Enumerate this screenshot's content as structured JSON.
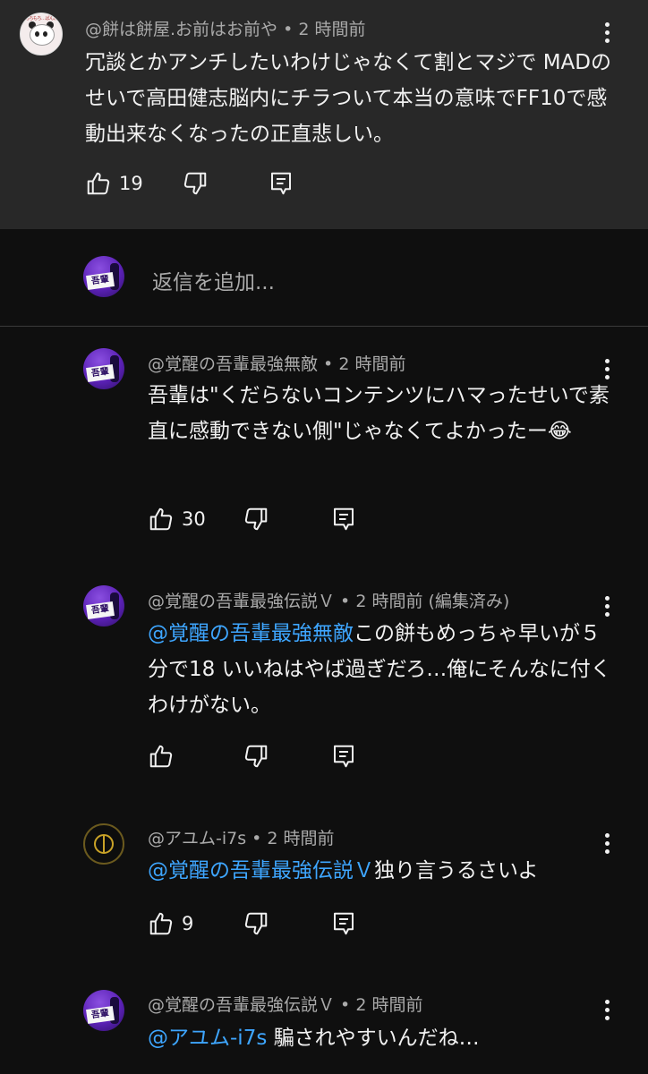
{
  "parent": {
    "author": "@餅は餅屋.お前はお前や",
    "time": "2 時間前",
    "text": "冗談とかアンチしたいわけじゃなくて割とマジで MADのせいで高田健志脳内にチラついて本当の意味でFF10で感動出来なくなったの正直悲しい。",
    "likes": "19",
    "avatar_text": "もちもち…ぱんだ"
  },
  "reply_box": {
    "placeholder": "返信を追加..."
  },
  "avatar_label": "吾輩",
  "replies": [
    {
      "author": "@覚醒の吾輩最強無敵",
      "time": "2 時間前",
      "edited": "",
      "mention": "",
      "text": "吾輩は\"くだらないコンテンツにハマったせいで素直に感動できない側\"じゃなくてよかったー😂",
      "likes": "30"
    },
    {
      "author": "@覚醒の吾輩最強伝説Ｖ",
      "time": "2 時間前",
      "edited": "(編集済み)",
      "mention": "@覚醒の吾輩最強無敵",
      "text": "この餅もめっちゃ早いが５分で18 いいねはやば過ぎだろ…俺にそんなに付くわけがない。",
      "likes": ""
    },
    {
      "author": "@アユム-i7s",
      "time": "2 時間前",
      "edited": "",
      "mention": "@覚醒の吾輩最強伝説Ｖ",
      "text": "独り言うるさいよ",
      "likes": "9"
    },
    {
      "author": "@覚醒の吾輩最強伝説Ｖ",
      "time": "2 時間前",
      "edited": "",
      "mention": "@アユム-i7s",
      "text": " 騙されやすいんだね…",
      "likes": ""
    }
  ],
  "separator": " • "
}
